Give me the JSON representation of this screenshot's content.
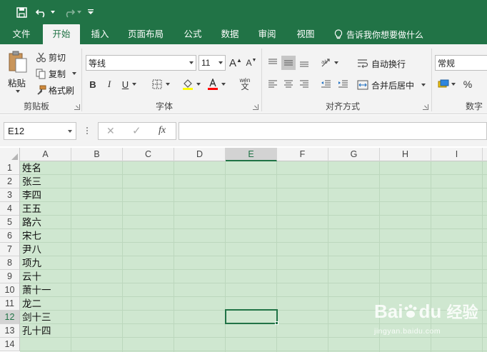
{
  "qat": {
    "save_icon": "save-icon",
    "undo_icon": "undo-icon",
    "redo_icon": "redo-icon",
    "customize_icon": "customize-qat-icon"
  },
  "tabs": [
    {
      "label": "文件"
    },
    {
      "label": "开始"
    },
    {
      "label": "插入"
    },
    {
      "label": "页面布局"
    },
    {
      "label": "公式"
    },
    {
      "label": "数据"
    },
    {
      "label": "审阅"
    },
    {
      "label": "视图"
    }
  ],
  "tell_me": "告诉我你想要做什么",
  "clipboard": {
    "paste": "粘贴",
    "cut": "剪切",
    "copy": "复制",
    "format_painter": "格式刷",
    "group_label": "剪贴板"
  },
  "font": {
    "name": "等线",
    "size": "11",
    "grow": "A",
    "shrink": "A",
    "bold": "B",
    "italic": "I",
    "underline": "U",
    "phonetic_top": "wén",
    "phonetic_bottom": "文",
    "group_label": "字体",
    "fill_color": "#ffff00",
    "font_color": "#ff0000"
  },
  "alignment": {
    "wrap_text": "自动换行",
    "merge_center": "合并后居中",
    "group_label": "对齐方式"
  },
  "number": {
    "format": "常规",
    "percent": "%",
    "group_label": "数字"
  },
  "formula_bar": {
    "name_box": "E12",
    "cancel": "✕",
    "enter": "✓",
    "fx": "fx",
    "formula": ""
  },
  "columns": [
    "A",
    "B",
    "C",
    "D",
    "E",
    "F",
    "G",
    "H",
    "I"
  ],
  "selected_column": "E",
  "rows": [
    "1",
    "2",
    "3",
    "4",
    "5",
    "6",
    "7",
    "8",
    "9",
    "10",
    "11",
    "12",
    "13",
    "14"
  ],
  "selected_row": "12",
  "column_a_values": [
    "姓名",
    "张三",
    "李四",
    "王五",
    "路六",
    "宋七",
    "尹八",
    "项九",
    "云十",
    "萧十一",
    "龙二",
    "剑十三",
    "孔十四",
    ""
  ],
  "watermark": {
    "brand": "Bai",
    "brand2": "du",
    "text": "经验",
    "url": "jingyan.baidu.com"
  },
  "colors": {
    "accent": "#217346",
    "sheet_fill": "#cfe7d0"
  }
}
